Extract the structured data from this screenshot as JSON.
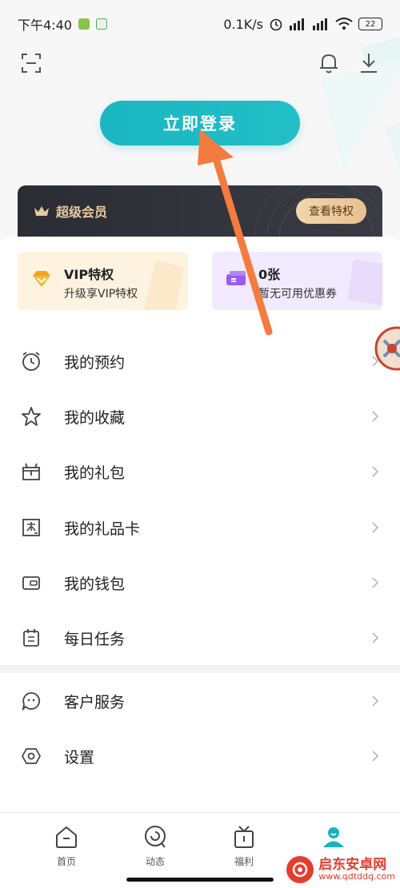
{
  "status_bar": {
    "time": "下午4:40",
    "speed": "0.1K/s",
    "battery": "22"
  },
  "header": {
    "login_label": "立即登录"
  },
  "vip_bar": {
    "title": "超级会员",
    "button_label": "查看特权"
  },
  "perks": [
    {
      "title": "VIP特权",
      "subtitle": "升级享VIP特权"
    },
    {
      "title": "0张",
      "subtitle": "暂无可用优惠券"
    }
  ],
  "menu": [
    {
      "label": "我的预约",
      "icon": "clock-icon"
    },
    {
      "label": "我的收藏",
      "icon": "star-icon"
    },
    {
      "label": "我的礼包",
      "icon": "gift-box-icon"
    },
    {
      "label": "我的礼品卡",
      "icon": "gift-card-icon"
    },
    {
      "label": "我的钱包",
      "icon": "wallet-icon"
    },
    {
      "label": "每日任务",
      "icon": "calendar-icon"
    }
  ],
  "menu2": [
    {
      "label": "客户服务",
      "icon": "service-chat-icon"
    },
    {
      "label": "设置",
      "icon": "settings-hexagon-icon"
    }
  ],
  "tabs": [
    {
      "label": "首页",
      "icon": "home-icon"
    },
    {
      "label": "动态",
      "icon": "feed-icon"
    },
    {
      "label": "福利",
      "icon": "gift-tv-icon"
    },
    {
      "label": "",
      "icon": "profile-icon",
      "active": true
    }
  ],
  "watermark": {
    "title": "启东安卓网",
    "url": "www.qdtddq.com"
  },
  "colors": {
    "accent": "#1ab6c2",
    "annotation_arrow": "#f47b3e",
    "vip_gold": "#e8caa0"
  }
}
